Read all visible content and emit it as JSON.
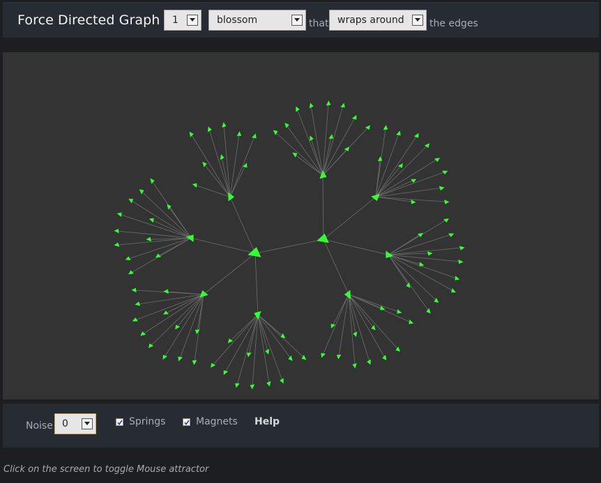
{
  "header": {
    "title": "Force Directed Graph",
    "count_select": "1",
    "shape_select": "blossom",
    "connector_text": "that",
    "edge_select": "wraps around",
    "suffix_text": "the edges"
  },
  "graph": {
    "node_color": "#33ff33",
    "edge_color": "#6e6e6e",
    "background": "#333333"
  },
  "controls": {
    "noise_label": "Noise",
    "noise_value": "0",
    "springs_label": "Springs",
    "springs_checked": true,
    "magnets_label": "Magnets",
    "magnets_checked": true,
    "help_label": "Help"
  },
  "footer": {
    "hint": "Click on the screen to toggle Mouse attractor"
  }
}
